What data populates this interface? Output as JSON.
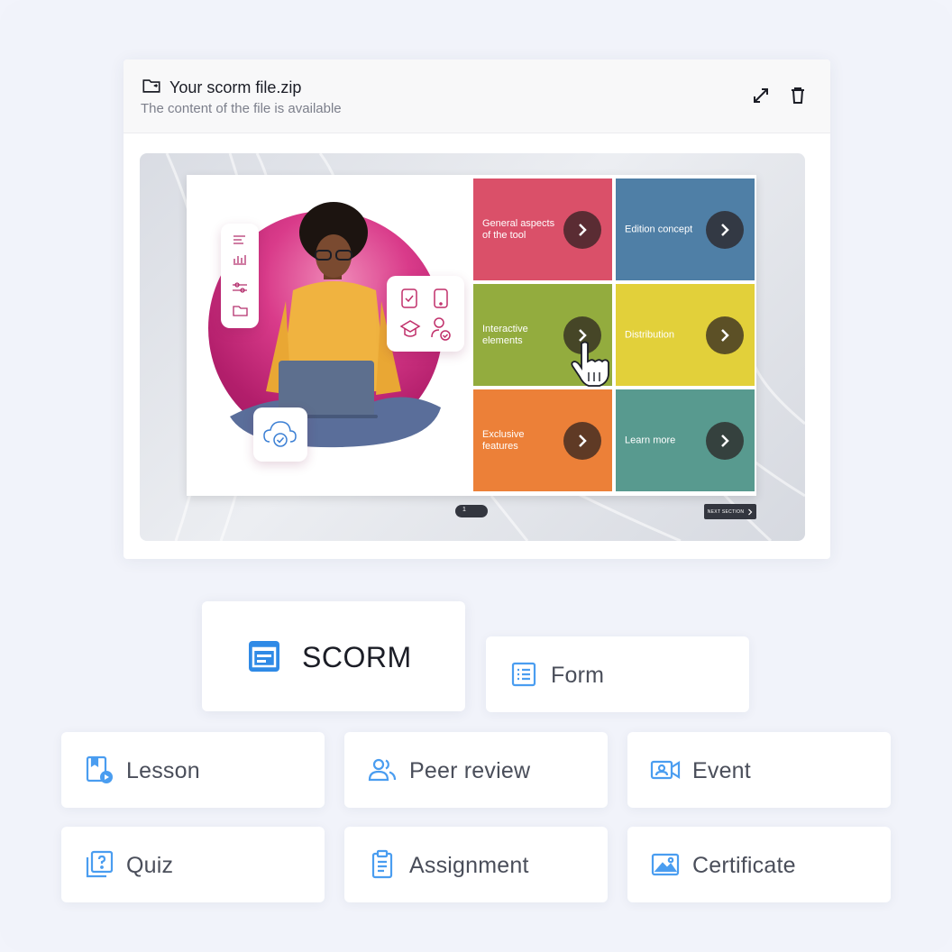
{
  "file": {
    "name": "Your scorm file.zip",
    "subtitle": "The content of the file is available"
  },
  "slide": {
    "tiles": [
      {
        "label": "General aspects of the tool",
        "color": "#da5069"
      },
      {
        "label": "Edition concept",
        "color": "#4f7fa6"
      },
      {
        "label": "Interactive elements",
        "color": "#93ac3e"
      },
      {
        "label": "Distribution",
        "color": "#e2d03a"
      },
      {
        "label": "Exclusive features",
        "color": "#ec8038"
      },
      {
        "label": "Learn more",
        "color": "#589a8f"
      }
    ],
    "page_number": "1",
    "next_label": "NEXT SECTION"
  },
  "activities": {
    "scorm": "SCORM",
    "form": "Form",
    "lesson": "Lesson",
    "peer_review": "Peer review",
    "event": "Event",
    "quiz": "Quiz",
    "assignment": "Assignment",
    "certificate": "Certificate"
  },
  "colors": {
    "accent": "#2f8ae6",
    "icon_blue": "#4a9df0",
    "background": "#f1f3fa"
  }
}
